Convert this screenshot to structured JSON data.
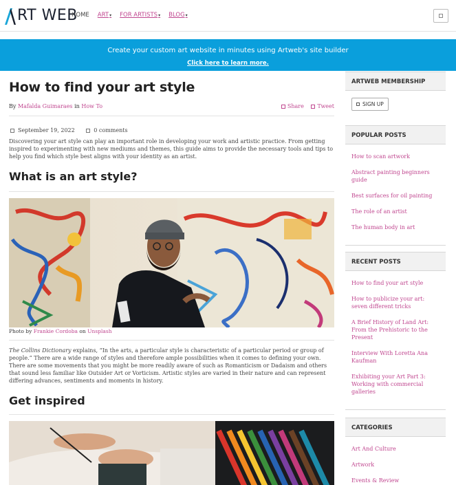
{
  "header": {
    "logo_text": "RT WEB",
    "logo_letter": "A",
    "nav": [
      {
        "label": "HOME",
        "dropdown": false
      },
      {
        "label": "ART",
        "dropdown": true
      },
      {
        "label": "FOR ARTISTS",
        "dropdown": true
      },
      {
        "label": "BLOG",
        "dropdown": true
      }
    ],
    "caret": "▾"
  },
  "banner": {
    "text": "Create your custom art website in minutes using Artweb's site builder",
    "link": "Click here to learn more."
  },
  "article": {
    "title": "How to find your art style",
    "byline_by": "By",
    "author": "Mafalda Guimaraes",
    "byline_in": "in",
    "category": "How To",
    "share": "Share",
    "tweet": "Tweet",
    "date": "September 19, 2022",
    "comments": "0 comments",
    "intro": "Discovering  your art style can play an important role in developing your work and artistic practice. From getting inspired to experimenting with new mediums and themes, this guide aims to provide the necessary tools and tips to help you find which style best aligns with your identity as an artist.",
    "h2_1": "What is an art style?",
    "photo_by": "Photo by",
    "photographer": "Frankie Cordoba",
    "photo_on": "on",
    "photo_source": "Unsplash",
    "source_italic": "The Collins Dictionary",
    "para2": " explains, “In the arts, a particular style is characteristic of a particular period or group of people.” There are a wide range of styles and therefore ample possibilities when it comes to defining your own. There are some movements that you might be more readily aware of such as Romanticism or Dadaism and others that sound less familiar like Outsider Art or Vorticism. Artistic styles are varied in their nature and can represent differing advances, sentiments and moments in history.",
    "h2_2": "Get inspired"
  },
  "sidebar": {
    "membership_title": "ARTWEB MEMBERSHIP",
    "signup": "SIGN UP",
    "popular_title": "POPULAR POSTS",
    "popular": [
      "How to scan artwork",
      "Abstract painting beginners guide",
      "Best surfaces for oil painting",
      "The role of an artist",
      "The human body in art"
    ],
    "recent_title": "RECENT POSTS",
    "recent": [
      "How to find your art style",
      "How to publicize your art: seven different tricks",
      "A Brief History of Land Art: From the Prehistoric to the Present",
      "Interview With Loretta Ana Kaufman",
      "Exhibiting your Art Part 3: Working with commercial galleries"
    ],
    "categories_title": "CATEGORIES",
    "categories": [
      "Art And Culture",
      "Artwork",
      "Events & Review"
    ]
  },
  "colors": {
    "accent": "#c0468f",
    "banner": "#0a9fdc",
    "logo_accent": "#1aa6d8"
  }
}
